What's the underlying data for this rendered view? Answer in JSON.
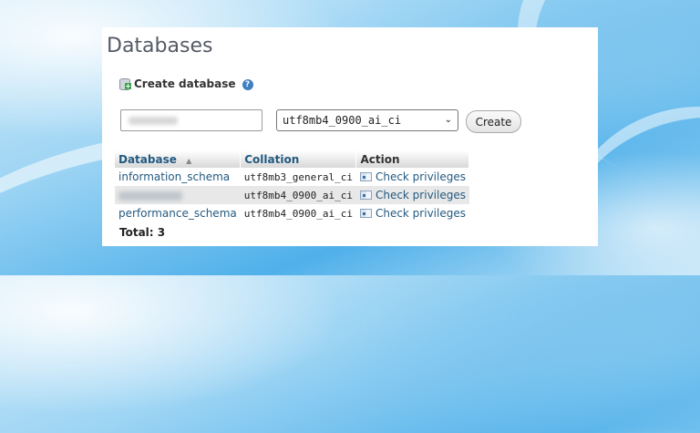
{
  "page": {
    "title": "Databases",
    "create_label": "Create database",
    "help_icon": "?"
  },
  "form": {
    "name_value": "",
    "collation_value": "utf8mb4_0900_ai_ci",
    "dropdown_icon": "⌄",
    "create_button": "Create"
  },
  "table": {
    "headers": {
      "database": "Database",
      "sort_icon": "▲",
      "collation": "Collation",
      "action": "Action"
    },
    "rows": [
      {
        "database": "information_schema",
        "collation": "utf8mb3_general_ci",
        "action": "Check privileges"
      },
      {
        "database": "",
        "collation": "utf8mb4_0900_ai_ci",
        "action": "Check privileges"
      },
      {
        "database": "performance_schema",
        "collation": "utf8mb4_0900_ai_ci",
        "action": "Check privileges"
      }
    ],
    "total": "Total: 3"
  },
  "colors": {
    "link": "#235a81",
    "title": "#555a66",
    "row_alt": "#e8e8e8"
  }
}
